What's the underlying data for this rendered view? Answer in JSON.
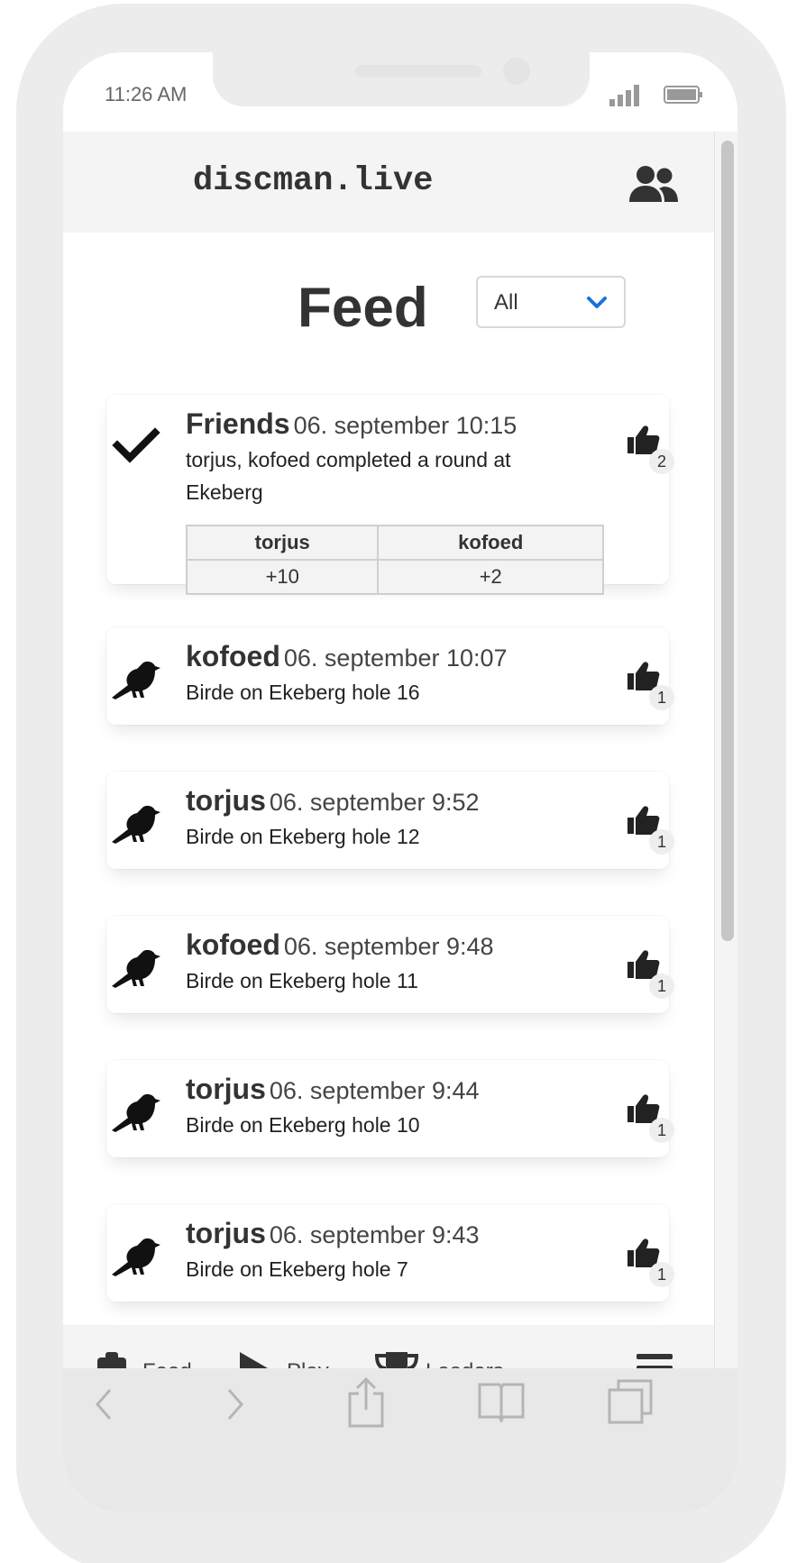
{
  "status": {
    "time": "11:26 AM"
  },
  "app": {
    "logo": "discman.live"
  },
  "page": {
    "title": "Feed",
    "filter_value": "All"
  },
  "feed": [
    {
      "type": "round",
      "who": "Friends",
      "when": "06. september 10:15",
      "text": "torjus, kofoed completed a round at Ekeberg",
      "likes": "2",
      "scores": {
        "headers": [
          "torjus",
          "kofoed"
        ],
        "values": [
          "+10",
          "+2"
        ]
      }
    },
    {
      "type": "birdie",
      "who": "kofoed",
      "when": "06. september 10:07",
      "text": "Birde on Ekeberg hole 16",
      "likes": "1"
    },
    {
      "type": "birdie",
      "who": "torjus",
      "when": "06. september 9:52",
      "text": "Birde on Ekeberg hole 12",
      "likes": "1"
    },
    {
      "type": "birdie",
      "who": "kofoed",
      "when": "06. september 9:48",
      "text": "Birde on Ekeberg hole 11",
      "likes": "1"
    },
    {
      "type": "birdie",
      "who": "torjus",
      "when": "06. september 9:44",
      "text": "Birde on Ekeberg hole 10",
      "likes": "1"
    },
    {
      "type": "birdie",
      "who": "torjus",
      "when": "06. september 9:43",
      "text": "Birde on Ekeberg hole 7",
      "likes": "1"
    }
  ],
  "tabs": {
    "feed": "Feed",
    "play": "Play",
    "leaders": "Leaders"
  },
  "icons": {
    "round": "checkmark-icon",
    "birdie": "crow-icon",
    "like": "thumbs-up-icon",
    "friends": "users-icon",
    "menu": "hamburger-menu-icon"
  },
  "colors": {
    "accent": "#1a73d9",
    "icon": "#222222"
  }
}
